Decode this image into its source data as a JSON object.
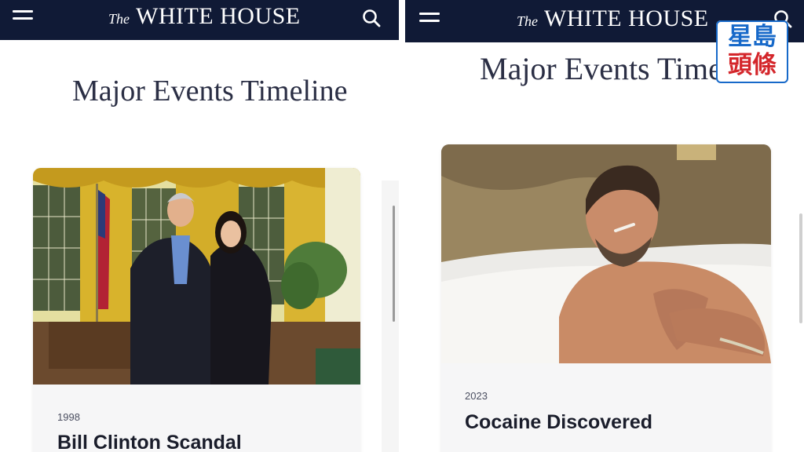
{
  "site": {
    "logo_prefix": "The",
    "logo_name": "WHITE HOUSE"
  },
  "page": {
    "title": "Major Events Timeline"
  },
  "cards": [
    {
      "year": "1998",
      "title": "Bill Clinton Scandal"
    },
    {
      "year": "2023",
      "title": "Cocaine Discovered"
    }
  ],
  "watermark": {
    "line1": "星島",
    "line2": "頭條"
  },
  "colors": {
    "header_bg": "#101a36",
    "card_bg": "#f6f6f7",
    "title_text": "#2b2f45",
    "watermark_blue": "#1769c9",
    "watermark_red": "#d4262b"
  },
  "icons": [
    "menu-icon",
    "search-icon"
  ]
}
